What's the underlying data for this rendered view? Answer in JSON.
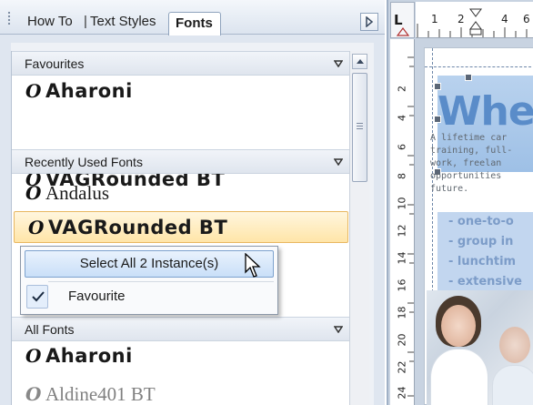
{
  "tabs": {
    "how_to": "How To",
    "separator": "|",
    "text_styles": "Text Styles",
    "fonts": "Fonts"
  },
  "sections": {
    "favourites": "Favourites",
    "recently_used": "Recently Used Fonts",
    "all_fonts": "All Fonts"
  },
  "font_icon_glyph": "O",
  "favourites": [
    "Aharoni",
    "VAGRounded BT"
  ],
  "recently_used": [
    "Andalus",
    "VAGRounded BT"
  ],
  "all_fonts": [
    "Aharoni",
    "Aldine401 BT"
  ],
  "context_menu": {
    "select_all": "Select All 2 Instance(s)",
    "favourite": "Favourite",
    "favourite_checked": true
  },
  "editor": {
    "corner_label": "L",
    "ruler_h": [
      "1",
      "2",
      "4",
      "6"
    ],
    "ruler_v": [
      "2",
      "4",
      "6",
      "8",
      "10",
      "12",
      "14",
      "16",
      "18",
      "20",
      "22",
      "24"
    ],
    "doc_title": "Whe",
    "doc_text": "A lifetime car\ntraining, full-\nwork, freelan\nopportunities\nfuture.",
    "doc_bullets": [
      "- one-to-o",
      "- group in",
      "- lunchtim",
      "- extensive"
    ]
  },
  "colors": {
    "selection_fill": "#ffe5a8",
    "menu_highlight": "#c9dff8",
    "doc_accent": "#5a8cc9"
  }
}
